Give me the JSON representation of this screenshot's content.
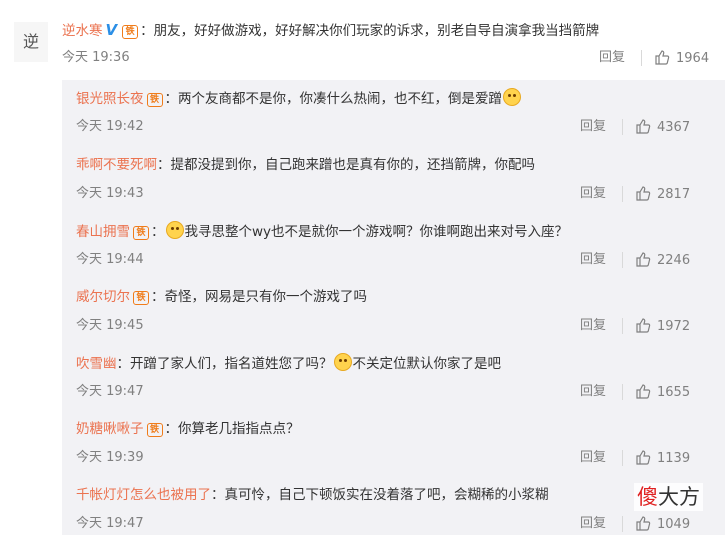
{
  "main_comment": {
    "user": "逆水寒",
    "text": "：朋友，好好做游戏，好好解决你们玩家的诉求，别老自导自演拿我当挡箭牌",
    "time": "今天 19:36",
    "reply_label": "回复",
    "likes": "1964"
  },
  "replies": [
    {
      "user": "银光照长夜",
      "text": "：两个友商都不是你，你凑什么热闹，也不红，倒是爱蹭",
      "time": "今天 19:42",
      "reply_label": "回复",
      "likes": "4367"
    },
    {
      "user": "乖啊不要死啊",
      "text": "：提都没提到你，自己跑来蹭也是真有你的，还挡箭牌，你配吗",
      "time": "今天 19:43",
      "reply_label": "回复",
      "likes": "2817"
    },
    {
      "user": "春山拥雪",
      "text": "我寻思整个wy也不是就你一个游戏啊？你谁啊跑出来对号入座？",
      "time": "今天 19:44",
      "reply_label": "回复",
      "likes": "2246"
    },
    {
      "user": "威尔切尔",
      "text": "：奇怪，网易是只有你一个游戏了吗",
      "time": "今天 19:45",
      "reply_label": "回复",
      "likes": "1972"
    },
    {
      "user": "吹雪幽",
      "text": "：开蹭了家人们，指名道姓您了吗？",
      "text2": "不关定位默认你家了是吧",
      "time": "今天 19:47",
      "reply_label": "回复",
      "likes": "1655"
    },
    {
      "user": "奶糖啾啾子",
      "text": "：你算老几指指点点？",
      "time": "今天 19:39",
      "reply_label": "回复",
      "likes": "1139"
    },
    {
      "user": "千帐灯灯怎么也被用了",
      "text": "：真可怜，自己下顿饭实在没着落了吧，会糊稀的小浆糊",
      "time": "今天 19:47",
      "reply_label": "回复",
      "likes": "1049"
    }
  ],
  "watermark": {
    "part1": "傻",
    "part2": "大方"
  },
  "colors": {
    "username": "#eb7350",
    "vip": "#2b8fe6",
    "badge": "#f07c1a",
    "panel_bg": "#f2f2f5",
    "meta": "#808080"
  },
  "icons": {
    "like": "thumbs-up-icon",
    "vip": "verified-v-icon",
    "badge": "fan-badge-icon",
    "emoji": "smiley-emoji-icon"
  }
}
